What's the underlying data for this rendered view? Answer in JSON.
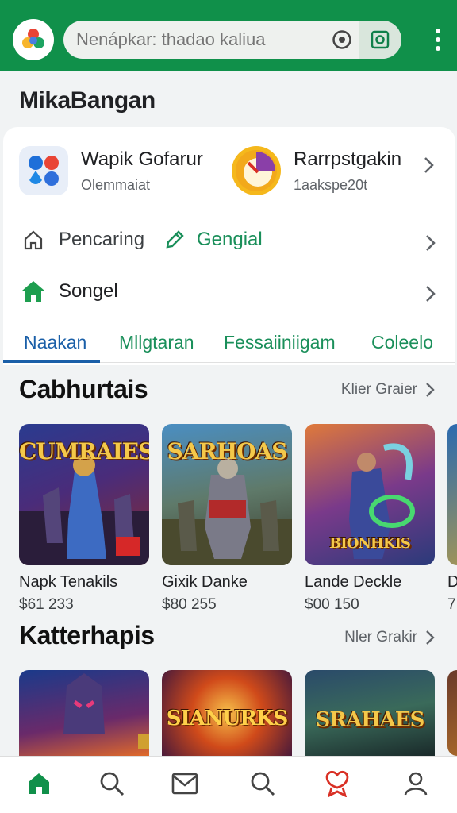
{
  "search": {
    "placeholder": "Nenápkar: thadao kaliua"
  },
  "page_title": "MikaBangan",
  "featured_apps": [
    {
      "name": "Wapik Gofarur",
      "sub": "Olemmaiat"
    },
    {
      "name": "Rarrpstgakin",
      "sub": "1aakspe20t"
    }
  ],
  "quick_links": {
    "pencaring": "Pencaring",
    "gengial": "Gengial",
    "songel": "Songel"
  },
  "tabs": [
    "Naakan",
    "Mllgtaran",
    "Fessaiiniigam",
    "Coleelo"
  ],
  "sections": [
    {
      "title": "Cabhurtais",
      "more": "Klier Graier",
      "games": [
        {
          "art_title": "CUMRAIES",
          "name": "Napk Tenakils",
          "price": "$61 233"
        },
        {
          "art_title": "SARHOAS",
          "name": "Gixik Danke",
          "price": "$80 255"
        },
        {
          "art_title": "BIONHKIS",
          "name": "Lande Deckle",
          "price": "$00 150"
        },
        {
          "art_title": "",
          "name": "D",
          "price": "7"
        }
      ]
    },
    {
      "title": "Katterhapis",
      "more": "Nler Grakir",
      "games": [
        {
          "art_title": "",
          "name": "",
          "price": ""
        },
        {
          "art_title": "SIANURKS",
          "name": "",
          "price": ""
        },
        {
          "art_title": "SRAHAES",
          "name": "",
          "price": ""
        }
      ]
    }
  ],
  "colors": {
    "brand_green": "#10904a",
    "tab_blue": "#1a5fa8",
    "link_green": "#1a8f5a",
    "fav_red": "#d93025"
  },
  "nav_icons": [
    "home-icon",
    "search-icon",
    "mail-icon",
    "search-icon",
    "favorite-icon",
    "profile-icon"
  ]
}
